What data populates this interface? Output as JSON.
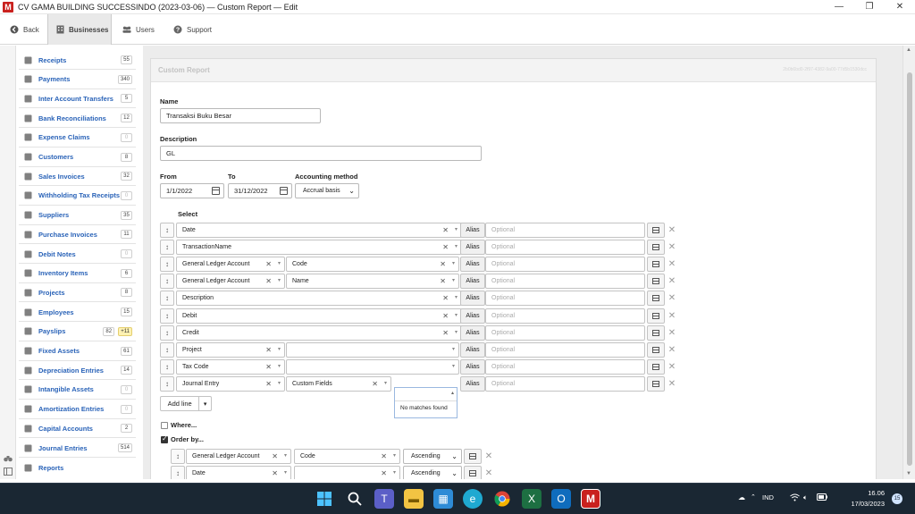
{
  "window": {
    "app_letter": "M",
    "title": "CV GAMA BUILDING SUCCESSINDO (2023-03-06) — Custom Report — Edit",
    "minimize": "—",
    "maximize": "❐",
    "close": "✕"
  },
  "toolbar": {
    "back": "Back",
    "businesses": "Businesses",
    "users": "Users",
    "support": "Support"
  },
  "sidebar": {
    "items": [
      {
        "label": "Receipts",
        "count": "55",
        "icon": "receipt-icon"
      },
      {
        "label": "Payments",
        "count": "340",
        "icon": "payment-icon"
      },
      {
        "label": "Inter Account Transfers",
        "count": "5",
        "icon": "transfer-icon"
      },
      {
        "label": "Bank Reconciliations",
        "count": "12",
        "icon": "clipboard-icon"
      },
      {
        "label": "Expense Claims",
        "count": "0",
        "icon": "expense-icon"
      },
      {
        "label": "Customers",
        "count": "8",
        "icon": "customers-icon"
      },
      {
        "label": "Sales Invoices",
        "count": "32",
        "icon": "invoice-icon"
      },
      {
        "label": "Withholding Tax Receipts",
        "count": "0",
        "icon": "tax-receipt-icon"
      },
      {
        "label": "Suppliers",
        "count": "35",
        "icon": "suppliers-icon"
      },
      {
        "label": "Purchase Invoices",
        "count": "11",
        "icon": "purchase-icon"
      },
      {
        "label": "Debit Notes",
        "count": "0",
        "icon": "scissors-icon"
      },
      {
        "label": "Inventory Items",
        "count": "6",
        "icon": "inventory-icon"
      },
      {
        "label": "Projects",
        "count": "8",
        "icon": "projects-icon"
      },
      {
        "label": "Employees",
        "count": "15",
        "icon": "employees-icon"
      },
      {
        "label": "Payslips",
        "count": "82",
        "extra": "+11",
        "icon": "payslip-icon"
      },
      {
        "label": "Fixed Assets",
        "count": "61",
        "icon": "fixed-assets-icon"
      },
      {
        "label": "Depreciation Entries",
        "count": "14",
        "icon": "depreciation-icon"
      },
      {
        "label": "Intangible Assets",
        "count": "0",
        "icon": "intangible-icon"
      },
      {
        "label": "Amortization Entries",
        "count": "0",
        "icon": "amortization-icon"
      },
      {
        "label": "Capital Accounts",
        "count": "2",
        "icon": "capital-icon"
      },
      {
        "label": "Journal Entries",
        "count": "514",
        "icon": "scale-icon"
      },
      {
        "label": "Reports",
        "count": "",
        "icon": "printer-icon"
      }
    ]
  },
  "form": {
    "panel_title": "Custom Report",
    "panel_id": "2b0b6bd0-2f97-4382-9a00-77d5b1530dcc",
    "name_label": "Name",
    "name_value": "Transaksi Buku Besar",
    "description_label": "Description",
    "description_value": "GL",
    "from_label": "From",
    "from_value": "1/1/2022",
    "to_label": "To",
    "to_value": "31/12/2022",
    "method_label": "Accounting method",
    "method_value": "Accrual basis",
    "select_label": "Select",
    "alias_label": "Alias",
    "alias_placeholder": "Optional",
    "rows": [
      {
        "f1": "Date",
        "f2": null
      },
      {
        "f1": "TransactionName",
        "f2": null
      },
      {
        "f1": "General Ledger Account",
        "f2": "Code"
      },
      {
        "f1": "General Ledger Account",
        "f2": "Name"
      },
      {
        "f1": "Description",
        "f2": null
      },
      {
        "f1": "Debit",
        "f2": null
      },
      {
        "f1": "Credit",
        "f2": null
      },
      {
        "f1": "Project",
        "f2": ""
      },
      {
        "f1": "Tax Code",
        "f2": ""
      },
      {
        "f1": "Journal Entry",
        "f2": "Custom Fields",
        "f3": ""
      }
    ],
    "no_matches": "No matches found",
    "add_line": "Add line",
    "where_label": "Where...",
    "orderby_label": "Order by...",
    "order_rows": [
      {
        "f1": "General Ledger Account",
        "f2": "Code",
        "dir": "Ascending"
      },
      {
        "f1": "Date",
        "f2": "",
        "dir": "Ascending"
      }
    ]
  },
  "taskbar": {
    "lang": "IND",
    "time": "16.06",
    "date": "17/03/2023",
    "notifications": "15"
  }
}
